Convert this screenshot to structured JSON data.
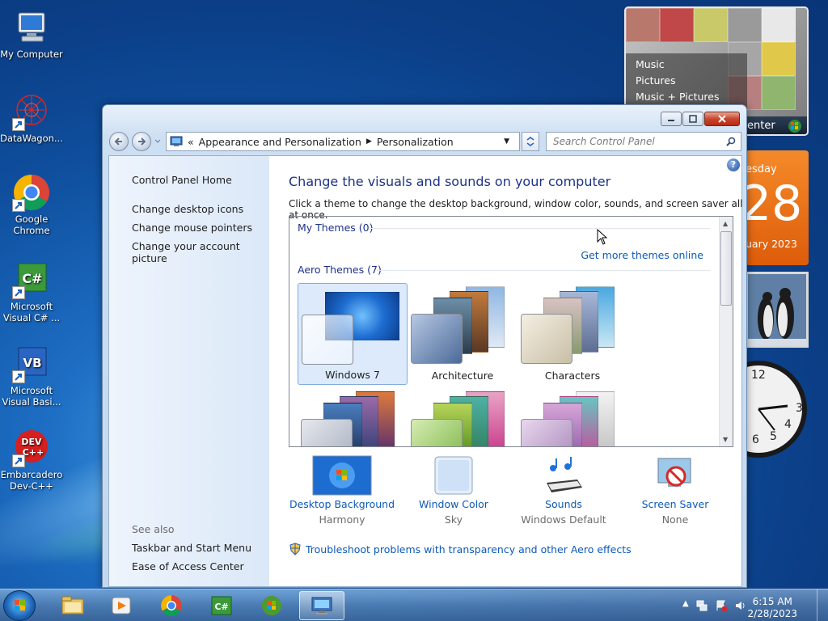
{
  "desktop": {
    "icons": [
      {
        "label": "My Computer"
      },
      {
        "label": "DataWagon..."
      },
      {
        "label": "Google Chrome"
      },
      {
        "label": "Microsoft Visual C# ..."
      },
      {
        "label": "Microsoft Visual Basi..."
      },
      {
        "label": "Embarcadero Dev-C++"
      }
    ]
  },
  "gadgets": {
    "media_center": {
      "items": [
        "Music",
        "Pictures",
        "Music + Pictures"
      ],
      "bar_label": "enter"
    },
    "calendar": {
      "weekday": "esday",
      "day": "28",
      "month_year": "uary 2023"
    },
    "clock": {
      "numbers": [
        "12",
        "3",
        "6",
        "5",
        "4"
      ]
    }
  },
  "window": {
    "address": {
      "chevron": "«",
      "crumbs": [
        "Appearance and Personalization",
        "Personalization"
      ]
    },
    "search_placeholder": "Search Control Panel",
    "sidebar": {
      "home": "Control Panel Home",
      "links": [
        "Change desktop icons",
        "Change mouse pointers",
        "Change your account picture"
      ],
      "see_also": "See also",
      "see_also_links": [
        "Taskbar and Start Menu",
        "Ease of Access Center"
      ]
    },
    "main": {
      "heading": "Change the visuals and sounds on your computer",
      "subtext": "Click a theme to change the desktop background, window color, sounds, and screen saver all at once.",
      "my_themes": "My Themes (0)",
      "get_more": "Get more themes online",
      "aero_themes": "Aero Themes (7)",
      "themes": [
        {
          "label": "Windows 7",
          "selected": true
        },
        {
          "label": "Architecture",
          "selected": false
        },
        {
          "label": "Characters",
          "selected": false
        }
      ],
      "bottom": [
        {
          "label": "Desktop Background",
          "value": "Harmony",
          "icon": "desktop-background-icon"
        },
        {
          "label": "Window Color",
          "value": "Sky",
          "icon": "window-color-icon"
        },
        {
          "label": "Sounds",
          "value": "Windows Default",
          "icon": "sounds-icon"
        },
        {
          "label": "Screen Saver",
          "value": "None",
          "icon": "screen-saver-icon"
        }
      ],
      "troubleshoot": "Troubleshoot problems with transparency and other Aero effects"
    }
  },
  "taskbar": {
    "time": "6:15 AM",
    "date": "2/28/2023"
  }
}
